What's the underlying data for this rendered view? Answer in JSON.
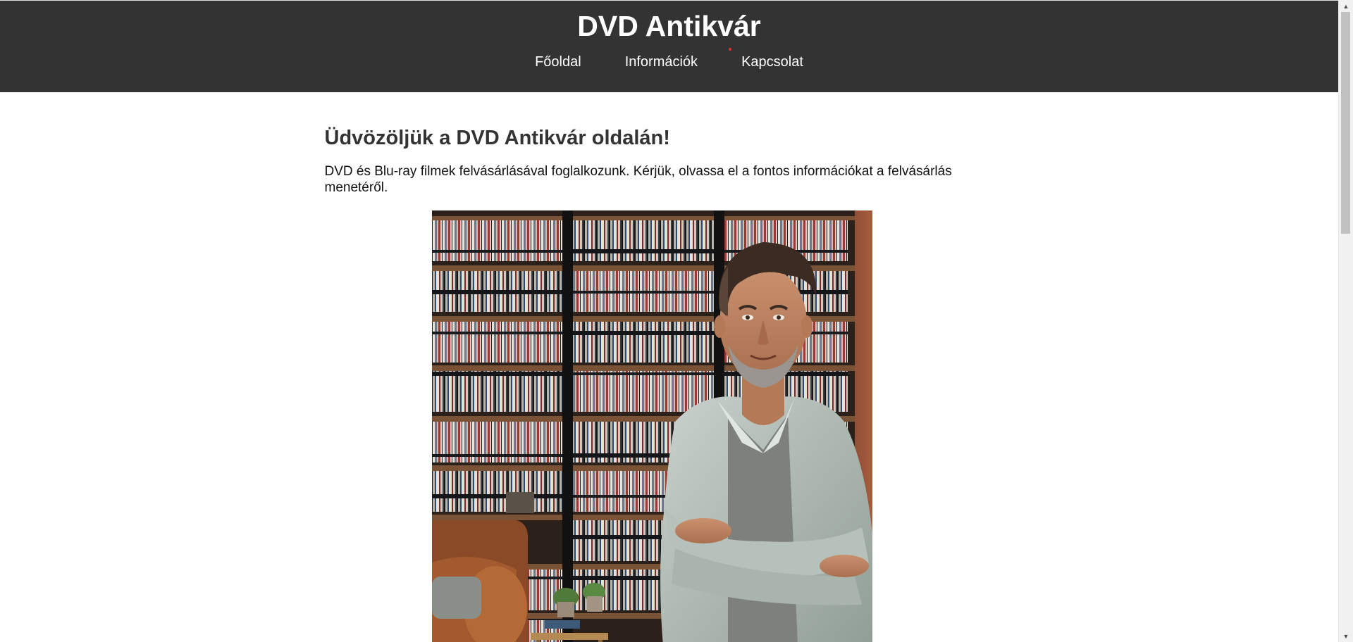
{
  "header": {
    "site_title": "DVD Antikvár",
    "background_color": "#333333"
  },
  "nav": {
    "items": [
      {
        "label": "Főoldal"
      },
      {
        "label": "Információk"
      },
      {
        "label": "Kapcsolat"
      }
    ]
  },
  "main": {
    "welcome_title": "Üdvözöljük a DVD Antikvár oldalán!",
    "intro_text": "DVD és Blu-ray filmek felvásárlásával foglalkozunk. Kérjük, olvassa el a fontos információkat a felvásárlás menetéről."
  },
  "hero": {
    "icon": "photo-dvd-collector"
  },
  "scrollbar": {
    "up_icon": "▲",
    "down_icon": "▼"
  }
}
